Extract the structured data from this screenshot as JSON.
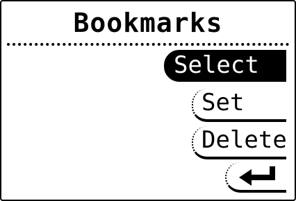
{
  "screen": {
    "title": "Bookmarks"
  },
  "menu": {
    "items": [
      {
        "label": "Select",
        "selected": true
      },
      {
        "label": "Set",
        "selected": false
      },
      {
        "label": "Delete",
        "selected": false
      }
    ],
    "back": {
      "icon": "enter-return-icon"
    }
  },
  "colors": {
    "background": "#ffffff",
    "foreground": "#000000"
  }
}
